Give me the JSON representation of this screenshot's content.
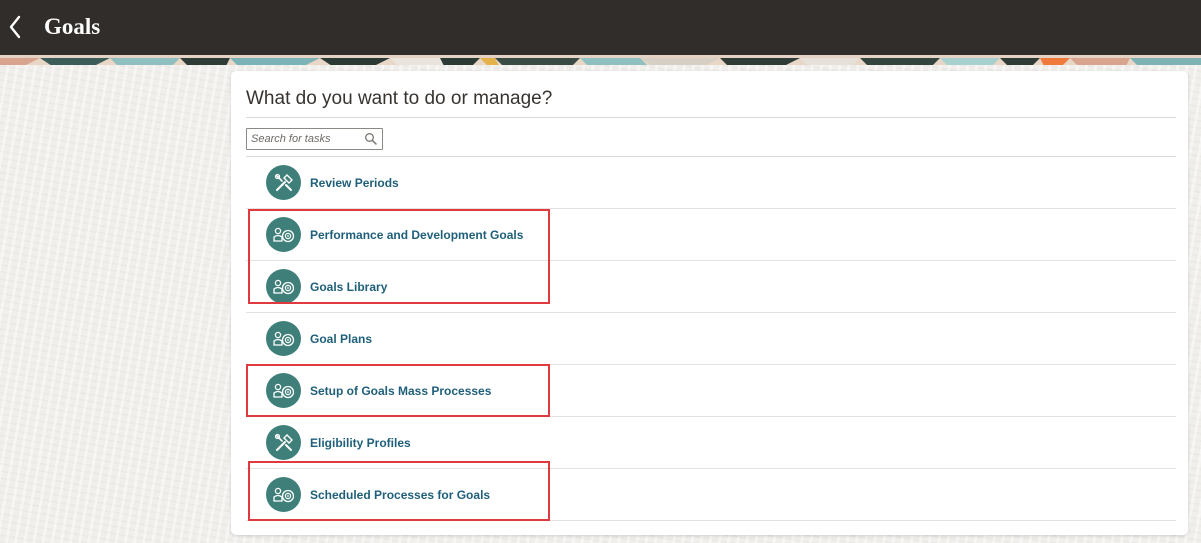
{
  "header": {
    "title": "Goals",
    "back_icon": "chevron-left-icon",
    "background_color": "#312d2a"
  },
  "panel": {
    "heading": "What do you want to do or manage?",
    "search": {
      "placeholder": "Search for tasks",
      "value": "",
      "icon": "search-icon"
    },
    "tasks": [
      {
        "label": "Review Periods",
        "icon": "tools-icon"
      },
      {
        "label": "Performance and Development Goals",
        "icon": "goal-target-icon"
      },
      {
        "label": "Goals Library",
        "icon": "goal-target-icon"
      },
      {
        "label": "Goal Plans",
        "icon": "goal-target-icon"
      },
      {
        "label": "Setup of Goals Mass Processes",
        "icon": "goal-target-icon"
      },
      {
        "label": "Eligibility Profiles",
        "icon": "tools-icon"
      },
      {
        "label": "Scheduled Processes for Goals",
        "icon": "goal-target-icon"
      }
    ]
  },
  "colors": {
    "icon_circle": "#3f7f7a",
    "link_text": "#1f5f7a",
    "highlight_border": "#e0393e"
  }
}
